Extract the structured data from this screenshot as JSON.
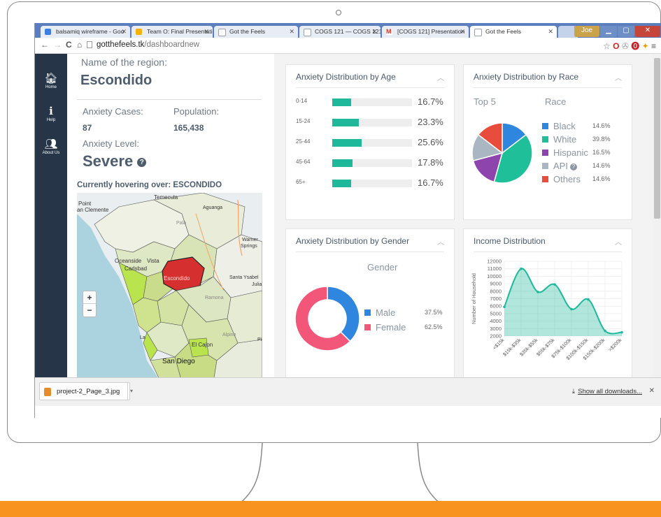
{
  "browser": {
    "tabs": [
      {
        "label": "balsamiq wireframe - Goo",
        "fav_color": "#3d7de0"
      },
      {
        "label": "Team O: Final Presentatio",
        "fav_color": "#f4b400"
      },
      {
        "label": "Got the Feels",
        "fav_color": "#9aa0a6"
      },
      {
        "label": "COGS 121 — COGS 121:",
        "fav_color": "#9aa0a6"
      },
      {
        "label": "[COGS 121] Presentation",
        "fav_color": "#d93025"
      },
      {
        "label": "Got the Feels",
        "fav_color": "#9aa0a6"
      }
    ],
    "window_user": "Joe",
    "url_host": "gotthefeels.tk",
    "url_path": "/dashboardnew"
  },
  "sidebar": {
    "items": [
      {
        "label": "Home",
        "icon": "home-icon"
      },
      {
        "label": "Help",
        "icon": "info-icon"
      },
      {
        "label": "About Us",
        "icon": "users-icon"
      }
    ]
  },
  "region": {
    "name_label": "Name of the region:",
    "name": "Escondido",
    "cases_label": "Anxiety Cases:",
    "cases": "87",
    "population_label": "Population:",
    "population": "165,438",
    "level_label": "Anxiety Level:",
    "level": "Severe",
    "hover_text": "Currently hovering over: ESCONDIDO"
  },
  "map": {
    "zoom_in": "+",
    "zoom_out": "−",
    "place_labels": [
      "Temecula",
      "Point",
      "an Clemente",
      "Aguanga",
      "Pala",
      "Warner",
      "Springs",
      "Oceanside",
      "Vista",
      "Carlsbad",
      "Escondido",
      "Santa Ysabel",
      "Julia",
      "Ramona",
      "Alpine",
      "La",
      "El Cajon",
      "San Diego",
      "Pi"
    ],
    "highlight_color": "#d62f2f"
  },
  "age_card": {
    "title": "Anxiety Distribution by Age",
    "rows": [
      {
        "label": "0-14",
        "pct": "16.7%",
        "value": 16.7
      },
      {
        "label": "15-24",
        "pct": "23.3%",
        "value": 23.3
      },
      {
        "label": "25-44",
        "pct": "25.6%",
        "value": 25.6
      },
      {
        "label": "45-64",
        "pct": "17.8%",
        "value": 17.8
      },
      {
        "label": "65+",
        "pct": "16.7%",
        "value": 16.7
      }
    ]
  },
  "race_card": {
    "title": "Anxiety Distribution by Race",
    "top_label": "Top 5",
    "race_label": "Race",
    "items": [
      {
        "name": "Black",
        "pct": "14.6%",
        "value": 14.6,
        "color": "#2e86de"
      },
      {
        "name": "White",
        "pct": "39.8%",
        "value": 39.8,
        "color": "#1fbf99"
      },
      {
        "name": "Hispanic",
        "pct": "16.5%",
        "value": 16.5,
        "color": "#8e44ad"
      },
      {
        "name": "API",
        "pct": "14.6%",
        "value": 14.6,
        "color": "#aab7c2"
      },
      {
        "name": "Others",
        "pct": "14.6%",
        "value": 14.6,
        "color": "#e74c3c"
      }
    ]
  },
  "gender_card": {
    "title": "Anxiety Distribution by Gender",
    "gender_label": "Gender",
    "items": [
      {
        "name": "Male",
        "pct": "37.5%",
        "value": 37.5,
        "color": "#2e86de"
      },
      {
        "name": "Female",
        "pct": "62.5%",
        "value": 62.5,
        "color": "#f2577a"
      }
    ]
  },
  "income_card": {
    "title": "Income Distribution",
    "chart_data": {
      "type": "area",
      "ylabel": "Number of Household",
      "ylim": [
        2000,
        12000
      ],
      "yticks": [
        "12000",
        "11000",
        "10000",
        "9000",
        "8000",
        "7000",
        "6000",
        "5000",
        "4000",
        "3000",
        "2000"
      ],
      "categories": [
        "<$15k",
        "$15k-$35k",
        "$35k-$55k",
        "$55k-$75k",
        "$75k-$100k",
        "$100k-$150k",
        "$150k-$200k",
        ">$200k"
      ],
      "values": [
        5900,
        11000,
        7900,
        8900,
        5600,
        6900,
        2700,
        2500
      ],
      "color": "#1fb89a"
    }
  },
  "downloads": {
    "file": "project-2_Page_3.jpg",
    "show_all": "Show all downloads..."
  }
}
